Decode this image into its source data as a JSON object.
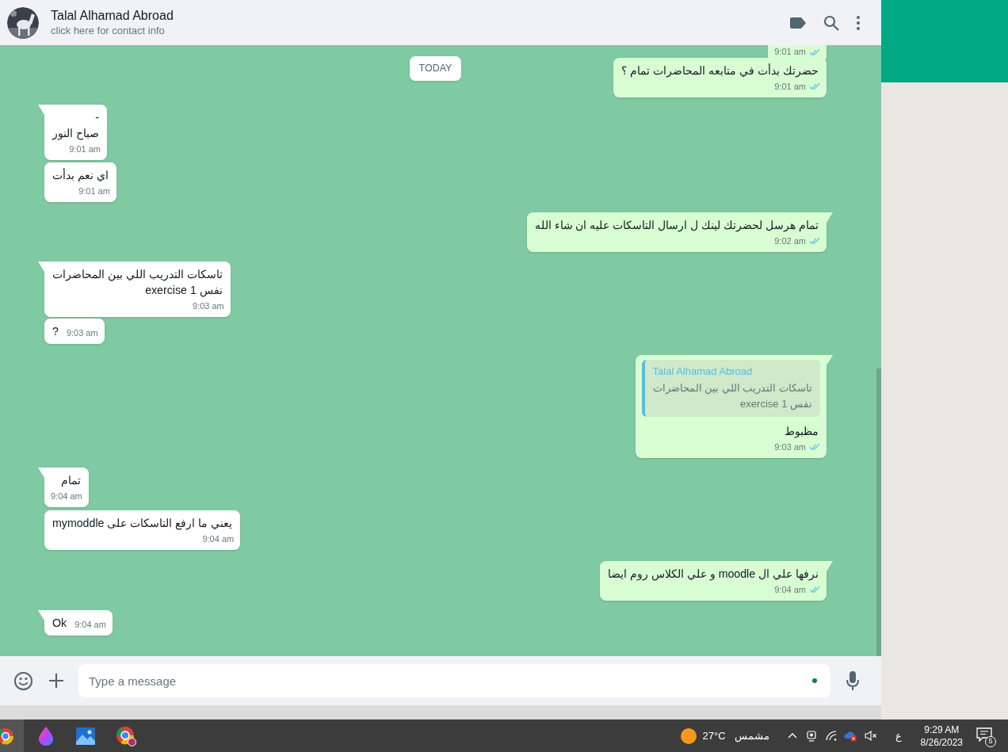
{
  "header": {
    "name": "Talal Alhamad Abroad",
    "subtitle": "click here for contact info"
  },
  "messages": [
    {
      "kind": "outgoing",
      "time": "9:01 am",
      "read": true,
      "tail": false
    },
    {
      "kind": "date",
      "text": "TODAY"
    },
    {
      "kind": "outgoing",
      "text": "حضرتك بدأت في متابعه المحاضرات تمام ؟",
      "time": "9:01 am",
      "read": true,
      "tail": false
    },
    {
      "kind": "incoming",
      "text": "-\nصباح النور",
      "time": "9:01 am",
      "tail": true
    },
    {
      "kind": "incoming",
      "text": "اي نعم بدأت",
      "time": "9:01 am",
      "tail": false
    },
    {
      "kind": "outgoing",
      "text": "تمام هرسل لحضرتك لينك ل ارسال التاسكات عليه ان شاء الله",
      "time": "9:02 am",
      "read": true,
      "tail": true
    },
    {
      "kind": "incoming",
      "text": "تاسكات التدريب اللي بين المحاضرات\nنفس 1 exercise",
      "time": "9:03 am",
      "tail": true
    },
    {
      "kind": "incoming",
      "text": "?",
      "time": "9:03 am",
      "tail": false
    },
    {
      "kind": "outgoing",
      "text": "مظبوط",
      "time": "9:03 am",
      "read": true,
      "tail": true,
      "quote": {
        "author": "Talal Alhamad Abroad",
        "text": "تاسكات التدريب اللي بين المحاضرات\nنفس 1 exercise"
      }
    },
    {
      "kind": "incoming",
      "text": "تمام",
      "time": "9:04 am",
      "tail": true
    },
    {
      "kind": "incoming",
      "text": "يعني ما ارفع التاسكات على mymoddle",
      "time": "9:04 am",
      "tail": false
    },
    {
      "kind": "outgoing",
      "text": "نرفها علي ال moodle و علي الكلاس روم ايضا",
      "time": "9:04 am",
      "read": true,
      "tail": true
    },
    {
      "kind": "incoming",
      "text": "Ok",
      "time": "9:04 am",
      "tail": true
    }
  ],
  "composer": {
    "placeholder": "Type a message"
  },
  "taskbar": {
    "weather_temp": "27°C",
    "weather_text": "مشمس",
    "input_language": "ع",
    "time": "9:29 AM",
    "date": "8/26/2023",
    "notifications": "5"
  }
}
